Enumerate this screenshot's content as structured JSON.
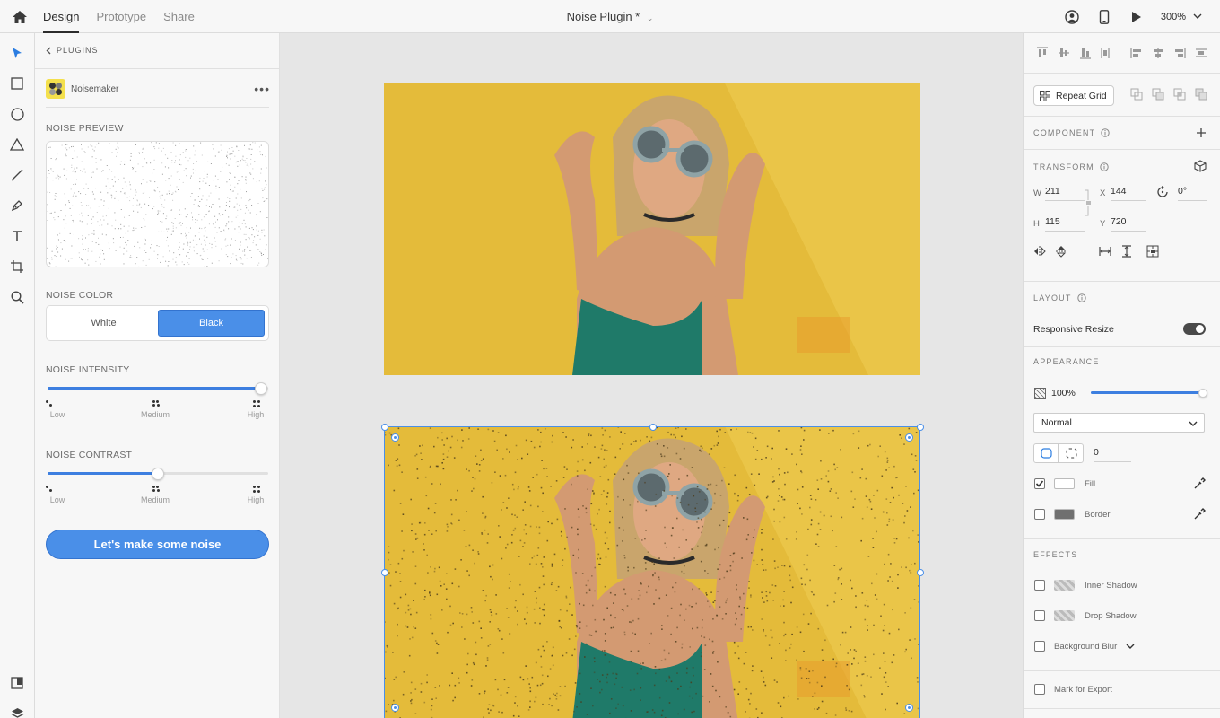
{
  "topbar": {
    "tabs": [
      {
        "label": "Design",
        "active": true
      },
      {
        "label": "Prototype",
        "active": false
      },
      {
        "label": "Share",
        "active": false
      }
    ],
    "doc_title": "Noise Plugin *",
    "zoom": "300%"
  },
  "toolbar": {
    "tools": [
      "select-icon",
      "rectangle-icon",
      "ellipse-icon",
      "triangle-icon",
      "line-icon",
      "pen-icon",
      "text-icon",
      "artboard-icon",
      "zoom-icon"
    ],
    "bottom_tools": [
      "assets-icon",
      "layers-icon"
    ]
  },
  "plugin": {
    "back_label": "PLUGINS",
    "name": "Noisemaker",
    "more": "•••",
    "preview_label": "NOISE PREVIEW",
    "color_label": "NOISE COLOR",
    "color_options": [
      "White",
      "Black"
    ],
    "color_selected": "Black",
    "intensity_label": "NOISE INTENSITY",
    "intensity_value": 1.0,
    "contrast_label": "NOISE CONTRAST",
    "contrast_value": 0.5,
    "scale_labels": [
      "Low",
      "Medium",
      "High"
    ],
    "cta": "Let's make some noise",
    "accent": "#4a8fe8"
  },
  "properties": {
    "repeat_grid": "Repeat Grid",
    "component_label": "COMPONENT",
    "transform_label": "TRANSFORM",
    "w_label": "W",
    "w": "211",
    "x_label": "X",
    "x": "144",
    "h_label": "H",
    "h": "115",
    "y_label": "Y",
    "y": "720",
    "rotation": "0°",
    "layout_label": "LAYOUT",
    "responsive_resize": "Responsive Resize",
    "responsive_on": true,
    "appearance_label": "APPEARANCE",
    "opacity": "100%",
    "opacity_value": 1.0,
    "blend_mode": "Normal",
    "radius": "0",
    "fill_label": "Fill",
    "fill_checked": true,
    "border_label": "Border",
    "border_checked": false,
    "effects_label": "EFFECTS",
    "inner_shadow": "Inner Shadow",
    "drop_shadow": "Drop Shadow",
    "background_blur": "Background Blur",
    "mark_export": "Mark for Export"
  }
}
